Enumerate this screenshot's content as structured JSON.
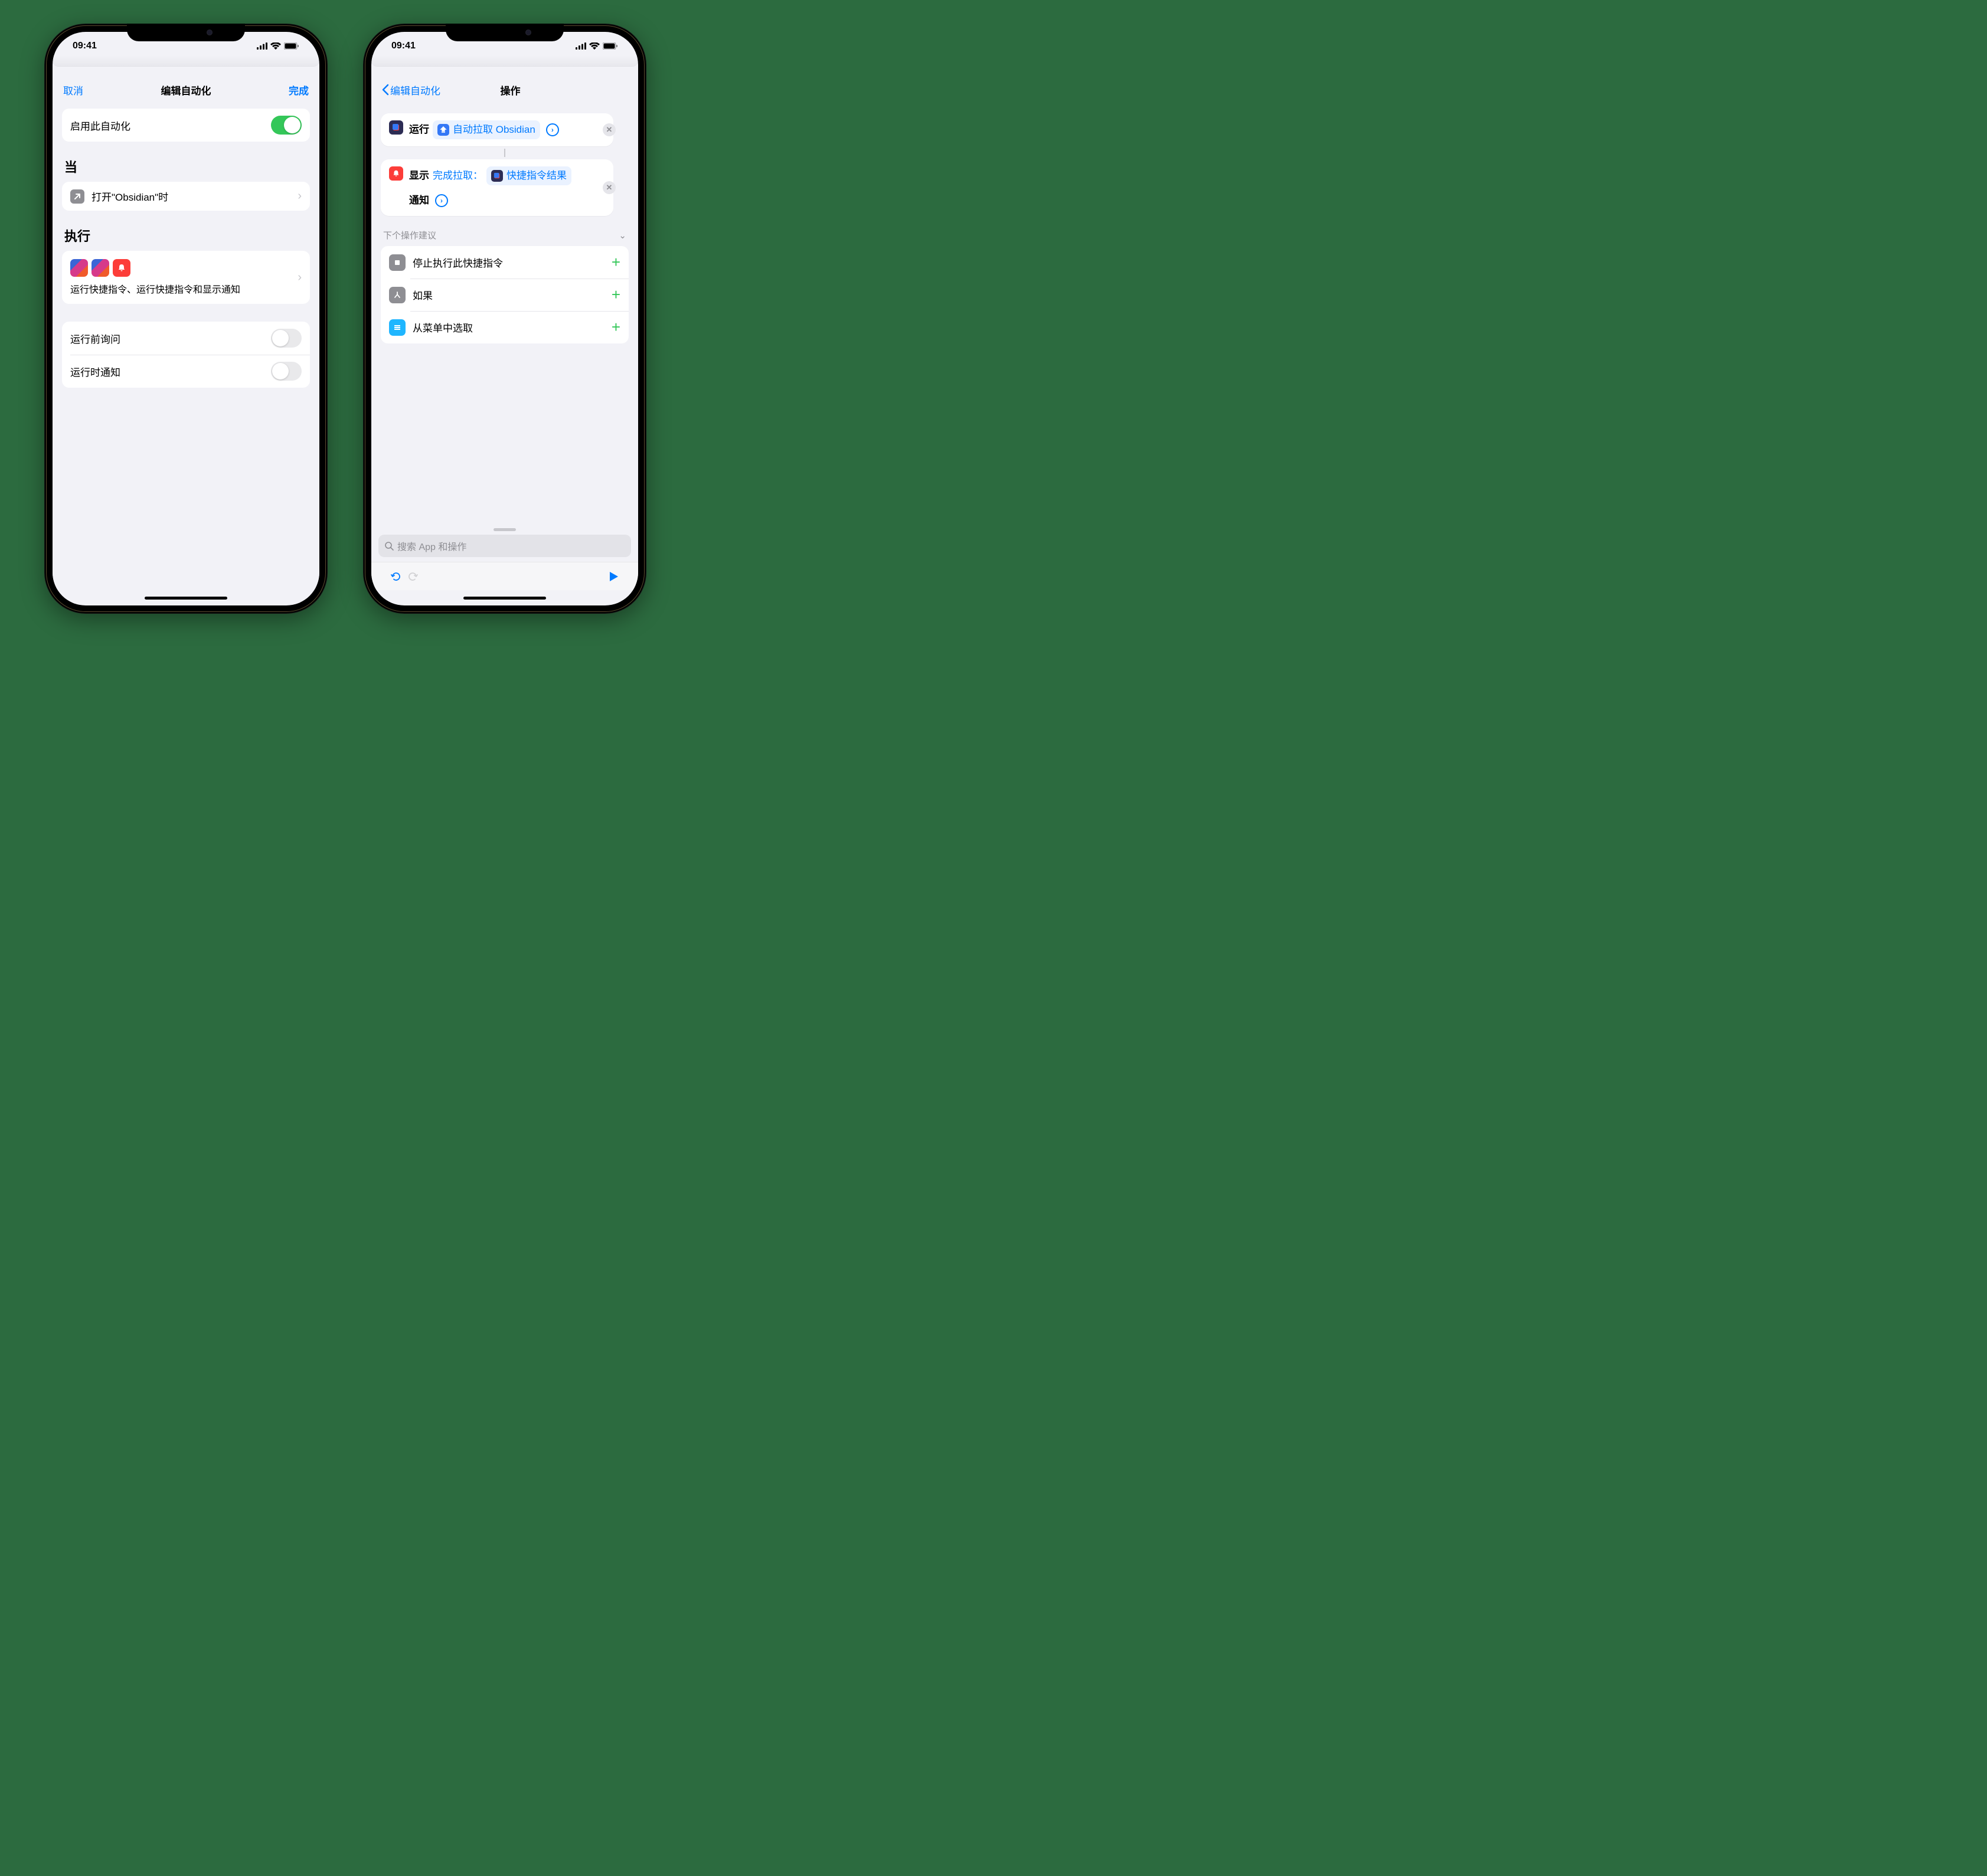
{
  "status": {
    "time": "09:41"
  },
  "left": {
    "nav": {
      "cancel": "取消",
      "title": "编辑自动化",
      "done": "完成"
    },
    "enable_row": {
      "label": "启用此自动化",
      "on": true
    },
    "when": {
      "header": "当",
      "trigger_label": "打开\"Obsidian\"时"
    },
    "do": {
      "header": "执行",
      "desc": "运行快捷指令、运行快捷指令和显示通知"
    },
    "options": {
      "ask_label": "运行前询问",
      "ask_on": false,
      "notify_label": "运行时通知",
      "notify_on": false
    }
  },
  "right": {
    "nav": {
      "back": "编辑自动化",
      "title": "操作"
    },
    "action1": {
      "verb": "运行",
      "token": "自动拉取 Obsidian"
    },
    "action2": {
      "verb": "显示",
      "text_prefix": "完成拉取：",
      "token": "快捷指令结果",
      "suffix": "通知"
    },
    "suggestions": {
      "header": "下个操作建议",
      "items": [
        "停止执行此快捷指令",
        "如果",
        "从菜单中选取"
      ]
    },
    "search_placeholder": "搜索 App 和操作"
  }
}
